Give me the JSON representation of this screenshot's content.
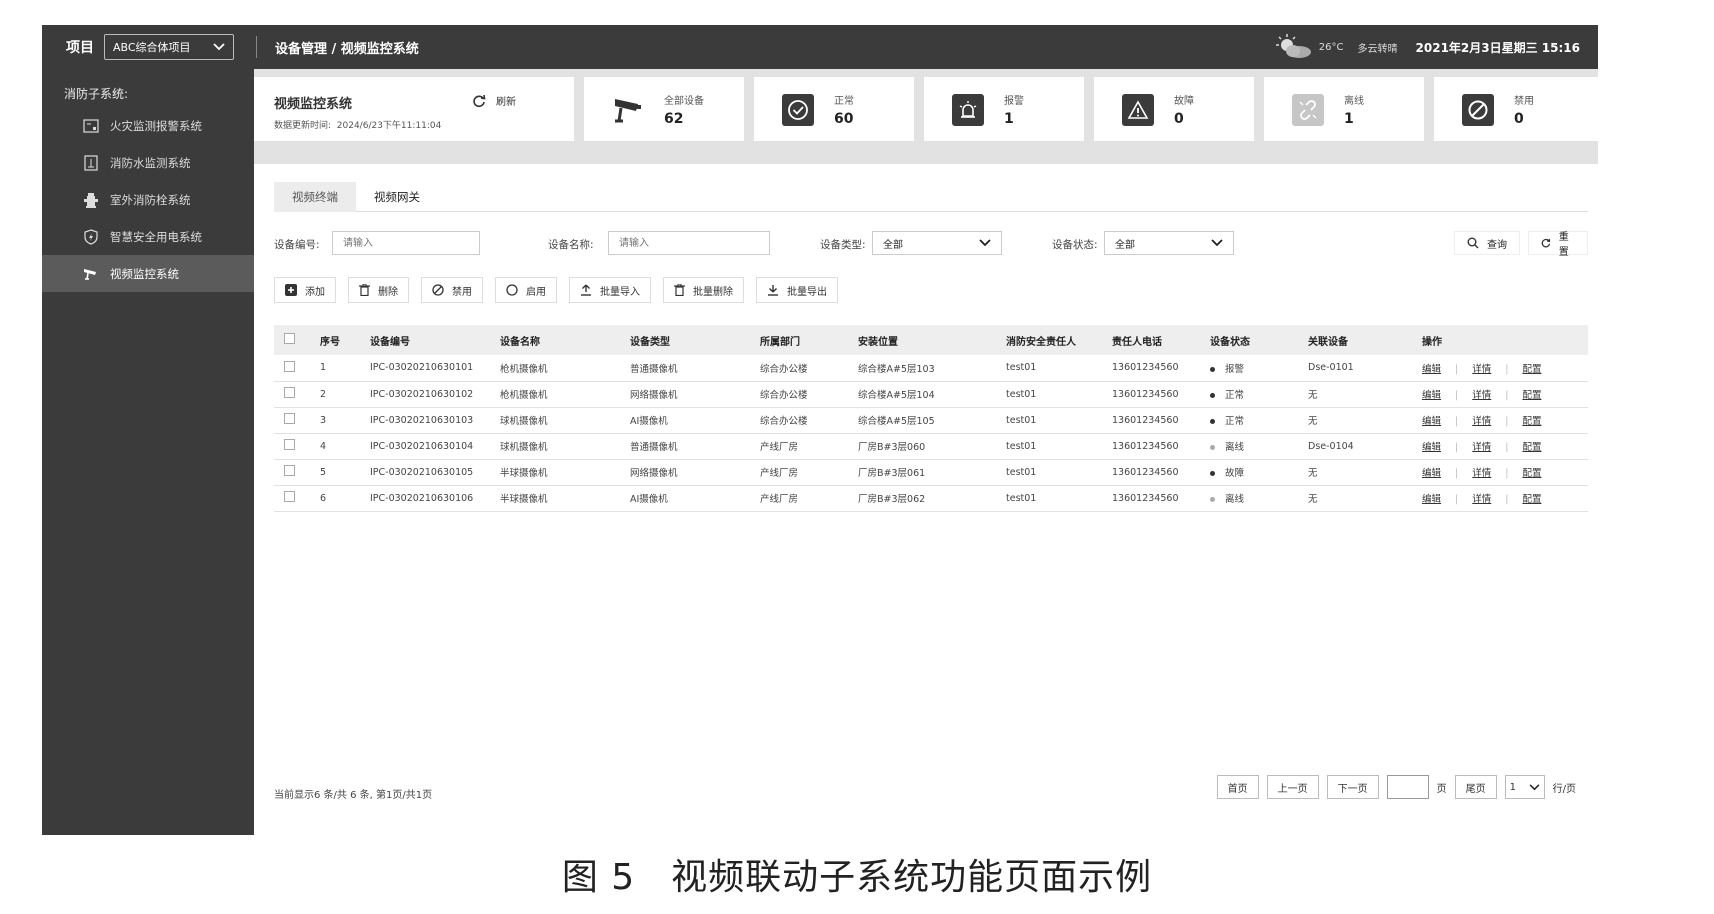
{
  "header": {
    "project_label": "项目",
    "project_select": "ABC综合体项目",
    "breadcrumb": "设备管理 / 视频监控系统",
    "temperature": "26°C",
    "weather": "多云转晴",
    "datetime": "2021年2月3日星期三 15:16"
  },
  "sidebar": {
    "title": "消防子系统:",
    "items": [
      {
        "label": "火灾监测报警系统",
        "icon": "fire-alarm-panel-icon"
      },
      {
        "label": "消防水监测系统",
        "icon": "water-gauge-icon"
      },
      {
        "label": "室外消防栓系统",
        "icon": "hydrant-icon"
      },
      {
        "label": "智慧安全用电系统",
        "icon": "shield-power-icon"
      },
      {
        "label": "视频监控系统",
        "icon": "camera-icon"
      }
    ]
  },
  "system_card": {
    "name": "视频监控系统",
    "update_label": "数据更新时间:",
    "update_time": "2024/6/23下午11:11:04",
    "refresh_label": "刷新"
  },
  "stats": [
    {
      "label": "全部设备",
      "value": "62",
      "icon": "camera-icon"
    },
    {
      "label": "正常",
      "value": "60",
      "icon": "check-circle-icon"
    },
    {
      "label": "报警",
      "value": "1",
      "icon": "alarm-siren-icon"
    },
    {
      "label": "故障",
      "value": "0",
      "icon": "warning-triangle-icon"
    },
    {
      "label": "离线",
      "value": "1",
      "icon": "broken-link-icon"
    },
    {
      "label": "禁用",
      "value": "0",
      "icon": "forbidden-icon"
    }
  ],
  "tabs": [
    "视频终端",
    "视频网关"
  ],
  "filters": {
    "device_no_label": "设备编号:",
    "device_no_placeholder": "请输入",
    "device_name_label": "设备名称:",
    "device_name_placeholder": "请输入",
    "device_type_label": "设备类型:",
    "device_type_value": "全部",
    "device_status_label": "设备状态:",
    "device_status_value": "全部",
    "search_label": "查询",
    "reset_label": "重置"
  },
  "toolbar": {
    "add": "添加",
    "delete": "删除",
    "disable": "禁用",
    "enable": "启用",
    "batch_import": "批量导入",
    "batch_delete": "批量删除",
    "batch_export": "批量导出"
  },
  "table": {
    "columns": [
      "序号",
      "设备编号",
      "设备名称",
      "设备类型",
      "所属部门",
      "安装位置",
      "消防安全责任人",
      "责任人电话",
      "设备状态",
      "关联设备",
      "操作"
    ],
    "op_labels": [
      "编辑",
      "详情",
      "配置"
    ],
    "rows": [
      {
        "no": "1",
        "code": "IPC-03020210630101",
        "name": "枪机摄像机",
        "type": "普通摄像机",
        "dept": "综合办公楼",
        "location": "综合楼A#5层103",
        "owner": "test01",
        "phone": "13601234560",
        "status": "报警",
        "status_color": "#333333",
        "linked": "Dse-0101"
      },
      {
        "no": "2",
        "code": "IPC-03020210630102",
        "name": "枪机摄像机",
        "type": "网络摄像机",
        "dept": "综合办公楼",
        "location": "综合楼A#5层104",
        "owner": "test01",
        "phone": "13601234560",
        "status": "正常",
        "status_color": "#333333",
        "linked": "无"
      },
      {
        "no": "3",
        "code": "IPC-03020210630103",
        "name": "球机摄像机",
        "type": "AI摄像机",
        "dept": "综合办公楼",
        "location": "综合楼A#5层105",
        "owner": "test01",
        "phone": "13601234560",
        "status": "正常",
        "status_color": "#333333",
        "linked": "无"
      },
      {
        "no": "4",
        "code": "IPC-03020210630104",
        "name": "球机摄像机",
        "type": "普通摄像机",
        "dept": "产线厂房",
        "location": "厂房B#3层060",
        "owner": "test01",
        "phone": "13601234560",
        "status": "离线",
        "status_color": "#aaaaaa",
        "linked": "Dse-0104"
      },
      {
        "no": "5",
        "code": "IPC-03020210630105",
        "name": "半球摄像机",
        "type": "网络摄像机",
        "dept": "产线厂房",
        "location": "厂房B#3层061",
        "owner": "test01",
        "phone": "13601234560",
        "status": "故障",
        "status_color": "#333333",
        "linked": "无"
      },
      {
        "no": "6",
        "code": "IPC-03020210630106",
        "name": "半球摄像机",
        "type": "AI摄像机",
        "dept": "产线厂房",
        "location": "厂房B#3层062",
        "owner": "test01",
        "phone": "13601234560",
        "status": "离线",
        "status_color": "#aaaaaa",
        "linked": "无"
      }
    ]
  },
  "footer": {
    "info": "当前显示6 条/共 6 条, 第1页/共1页",
    "first": "首页",
    "prev": "上一页",
    "next": "下一页",
    "page_unit": "页",
    "last": "尾页",
    "page_size": "1",
    "per_page_unit": "行/页"
  },
  "caption": {
    "figure": "图 5",
    "text": "视频联动子系统功能页面示例"
  }
}
